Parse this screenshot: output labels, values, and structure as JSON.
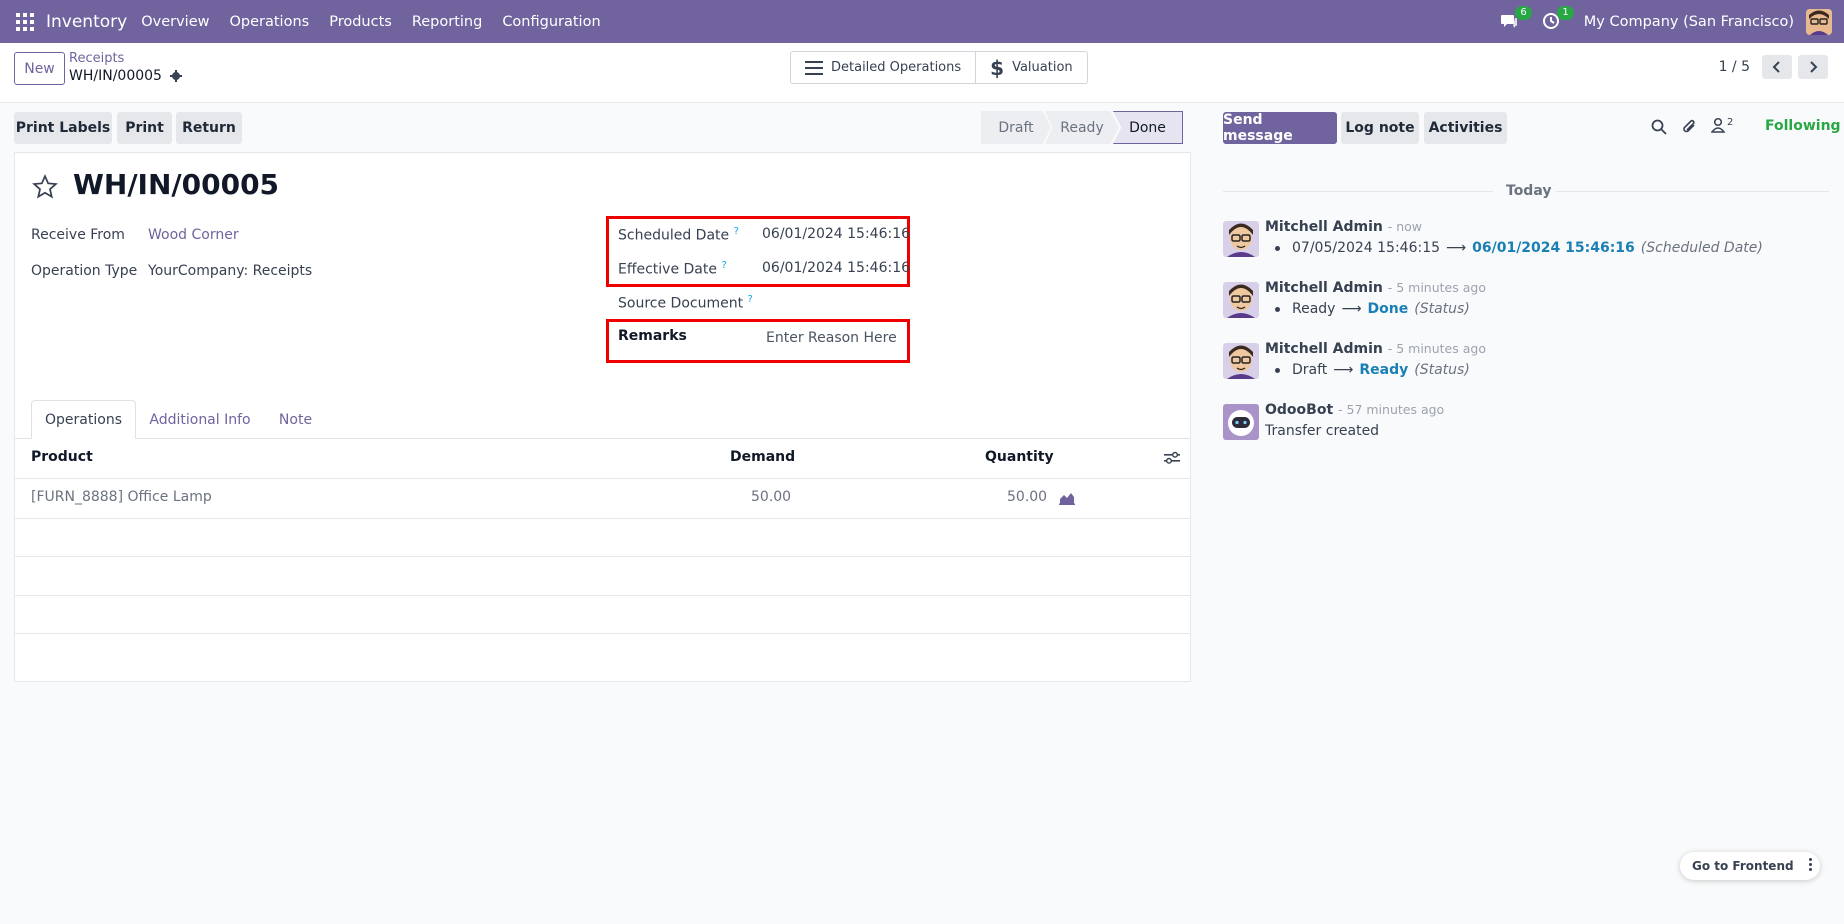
{
  "navbar": {
    "brand": "Inventory",
    "menus": [
      "Overview",
      "Operations",
      "Products",
      "Reporting",
      "Configuration"
    ],
    "messages_badge": "6",
    "activities_badge": "1",
    "company": "My Company (San Francisco)"
  },
  "control": {
    "new_label": "New",
    "breadcrumb_parent": "Receipts",
    "breadcrumb_current": "WH/IN/00005",
    "smart_buttons": [
      "Detailed Operations",
      "Valuation"
    ],
    "pager": "1 / 5"
  },
  "actions": [
    "Print Labels",
    "Print",
    "Return"
  ],
  "statusbar": [
    "Draft",
    "Ready",
    "Done"
  ],
  "form": {
    "title": "WH/IN/00005",
    "receive_from_label": "Receive From",
    "receive_from_value": "Wood Corner",
    "operation_type_label": "Operation Type",
    "operation_type_value": "YourCompany: Receipts",
    "scheduled_date_label": "Scheduled Date",
    "scheduled_date_value": "06/01/2024 15:46:16",
    "effective_date_label": "Effective Date",
    "effective_date_value": "06/01/2024 15:46:16",
    "source_document_label": "Source Document",
    "remarks_label": "Remarks",
    "remarks_placeholder": "Enter Reason Here",
    "help_mark": "?"
  },
  "tabs": [
    "Operations",
    "Additional Info",
    "Note"
  ],
  "table": {
    "headers": [
      "Product",
      "Demand",
      "Quantity"
    ],
    "rows": [
      {
        "product": "[FURN_8888] Office Lamp",
        "demand": "50.00",
        "quantity": "50.00"
      }
    ]
  },
  "chatter": {
    "send_message": "Send message",
    "log_note": "Log note",
    "activities": "Activities",
    "followers_count": "2",
    "following": "Following",
    "today": "Today",
    "messages": [
      {
        "author": "Mitchell Admin",
        "time": "- now",
        "old": "07/05/2024 15:46:15",
        "new": "06/01/2024 15:46:16",
        "field": "(Scheduled Date)"
      },
      {
        "author": "Mitchell Admin",
        "time": "- 5 minutes ago",
        "old": "Ready",
        "new": "Done",
        "field": "(Status)"
      },
      {
        "author": "Mitchell Admin",
        "time": "- 5 minutes ago",
        "old": "Draft",
        "new": "Ready",
        "field": "(Status)"
      },
      {
        "author": "OdooBot",
        "time": "- 57 minutes ago",
        "body": "Transfer created"
      }
    ]
  },
  "go_to_frontend": "Go to Frontend",
  "colors": {
    "brand": "#71639e",
    "following": "#28a745",
    "highlight": "#e00000",
    "link": "#1a7fb5"
  }
}
